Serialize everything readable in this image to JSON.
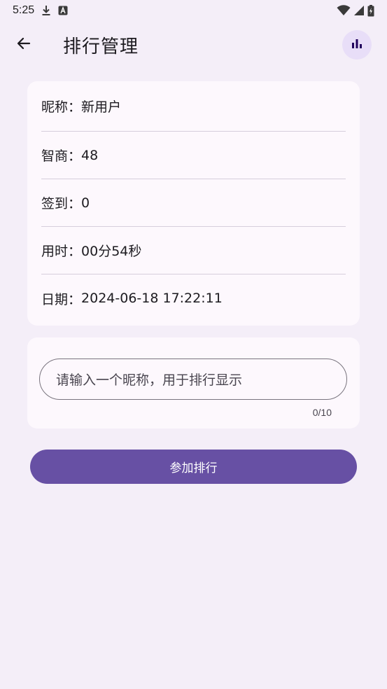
{
  "status_bar": {
    "time": "5:25",
    "icons_left": [
      "download-icon",
      "app-a-icon"
    ],
    "icons_right": [
      "wifi-icon",
      "signal-icon",
      "battery-icon"
    ]
  },
  "header": {
    "title": "排行管理",
    "back_icon": "arrow-left-icon",
    "action_icon": "bar-chart-icon"
  },
  "info": {
    "rows": [
      {
        "label": "昵称：",
        "value": "新用户"
      },
      {
        "label": "智商：",
        "value": "48"
      },
      {
        "label": "签到：",
        "value": "0"
      },
      {
        "label": "用时：",
        "value": "00分54秒"
      },
      {
        "label": "日期：",
        "value": "2024-06-18 17:22:11"
      }
    ]
  },
  "nickname_input": {
    "value": "",
    "placeholder": "请输入一个昵称，用于排行显示",
    "counter": "0/10"
  },
  "join_button": {
    "label": "参加排行"
  },
  "colors": {
    "background": "#F4EEF8",
    "card": "#FDF8FD",
    "primary": "#6750A4",
    "chip": "#E8DEF8"
  }
}
